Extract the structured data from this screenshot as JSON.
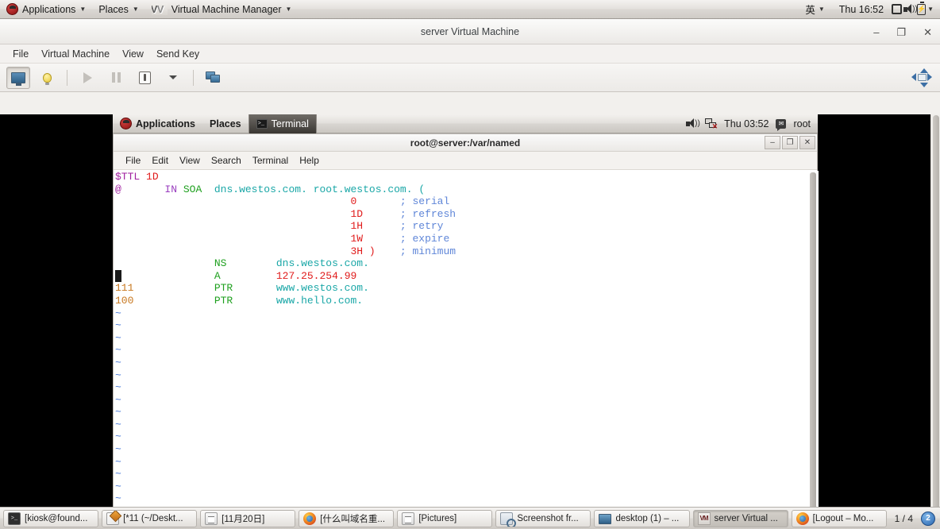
{
  "host_panel": {
    "applications": "Applications",
    "places": "Places",
    "active_app": "Virtual Machine Manager",
    "input_method": "英",
    "clock": "Thu 16:52",
    "icons": [
      "display-icon",
      "volume-icon",
      "battery-icon"
    ]
  },
  "vmm_window": {
    "title": "server Virtual Machine",
    "window_buttons": {
      "minimize": "‒",
      "maximize": "❐",
      "close": "✕"
    },
    "menus": [
      "File",
      "Virtual Machine",
      "View",
      "Send Key"
    ],
    "toolbar": {
      "console_icon": "monitor-icon",
      "details_icon": "lightbulb-icon",
      "run_icon": "play-icon",
      "pause_icon": "pause-icon",
      "shutdown_icon": "power-icon",
      "shutdown_caret": "▾",
      "snapshot_icon": "screens-icon",
      "fullscreen_icon": "fullscreen-icon"
    }
  },
  "guest_panel": {
    "applications": "Applications",
    "places": "Places",
    "terminal_task": "Terminal",
    "clock": "Thu 03:52",
    "user": "root",
    "icons": [
      "volume-icon",
      "network-disconnected-icon",
      "user-icon"
    ]
  },
  "terminal": {
    "title": "root@server:/var/named",
    "window_buttons": {
      "minimize": "‒",
      "maximize": "❐",
      "close": "✕"
    },
    "menus": [
      "File",
      "Edit",
      "View",
      "Search",
      "Terminal",
      "Help"
    ],
    "content": {
      "line1": {
        "ttl_key": "$TTL",
        "ttl_val": "1D"
      },
      "line2": {
        "at": "@",
        "in": "IN",
        "soa": "SOA",
        "primary": "dns.westos.com.",
        "contact": "root.westos.com.",
        "paren": "("
      },
      "soa_fields": [
        {
          "value": "0",
          "comment": "; serial"
        },
        {
          "value": "1D",
          "comment": "; refresh"
        },
        {
          "value": "1H",
          "comment": "; retry"
        },
        {
          "value": "1W",
          "comment": "; expire"
        },
        {
          "value": "3H )",
          "comment": "; minimum"
        }
      ],
      "records": [
        {
          "name": "",
          "type": "NS",
          "value": "dns.westos.com.",
          "value_color": "teal"
        },
        {
          "name": "",
          "type": "A",
          "value": "127.25.254.99",
          "value_color": "red",
          "cursor": true
        },
        {
          "name": "111",
          "type": "PTR",
          "value": "www.westos.com.",
          "value_color": "teal"
        },
        {
          "name": "100",
          "type": "PTR",
          "value": "www.hello.com.",
          "value_color": "teal"
        }
      ],
      "empty_marker": "~",
      "empty_lines": 17
    }
  },
  "taskbar": {
    "tasks": [
      {
        "label": "[kiosk@found...",
        "icon": "terminal-icon",
        "active": false
      },
      {
        "label": "[*11 (~/Deskt...",
        "icon": "text-editor-icon",
        "active": false
      },
      {
        "label": "[11月20日]",
        "icon": "document-icon",
        "active": false
      },
      {
        "label": "[什么叫域名重...",
        "icon": "firefox-icon",
        "active": false
      },
      {
        "label": "[Pictures]",
        "icon": "document-icon",
        "active": false
      },
      {
        "label": "Screenshot fr...",
        "icon": "screenshot-icon",
        "active": false
      },
      {
        "label": "desktop (1) – ...",
        "icon": "monitor-icon",
        "active": false
      },
      {
        "label": "server Virtual ...",
        "icon": "vmm-icon",
        "active": true
      },
      {
        "label": "[Logout – Mo...",
        "icon": "firefox-icon",
        "active": false
      }
    ],
    "pager": "1 / 4",
    "workspace_badge": "2"
  },
  "colors": {
    "terminal_bg": "#ffffff",
    "keyword_magenta": "#a020a0",
    "number_red": "#e01b1b",
    "type_purple": "#9a3fbf",
    "record_green": "#1fa01f",
    "string_teal": "#1aa7a7",
    "comment_blue": "#5f86d8",
    "name_orange": "#c87820",
    "tilde_blue": "#4a7ad8"
  }
}
